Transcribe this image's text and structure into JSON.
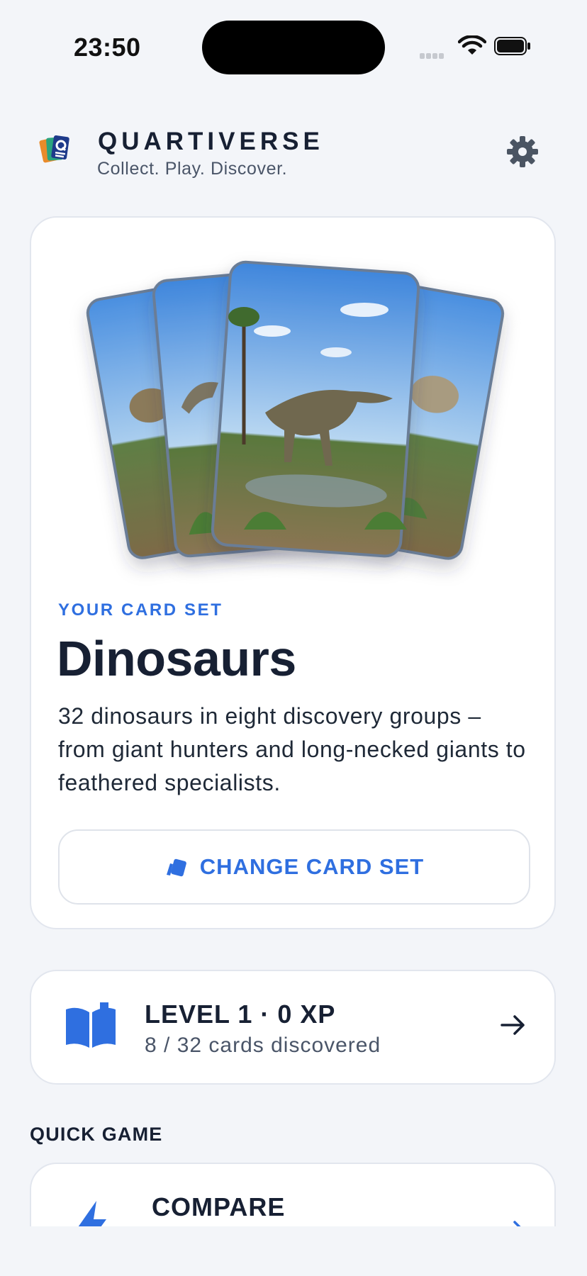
{
  "status": {
    "time": "23:50"
  },
  "header": {
    "brand": "QUARTIVERSE",
    "tagline": "Collect. Play. Discover.",
    "logo_icon": "card-deck-logo-icon",
    "settings_icon": "gear-icon"
  },
  "hero": {
    "kicker": "YOUR CARD SET",
    "title": "Dinosaurs",
    "description": "32 dinosaurs in eight discovery groups – from giant hunters and long-necked giants to feathered specialists.",
    "change_label": "CHANGE CARD SET"
  },
  "progress": {
    "title": "LEVEL 1 · 0 XP",
    "subtitle": "8 / 32 cards discovered",
    "discovered": 8,
    "total": 32
  },
  "quick_game": {
    "label": "QUICK GAME",
    "compare_title": "COMPARE"
  },
  "colors": {
    "accent": "#2f6fe0",
    "text": "#172033",
    "background": "#f3f5f9"
  }
}
